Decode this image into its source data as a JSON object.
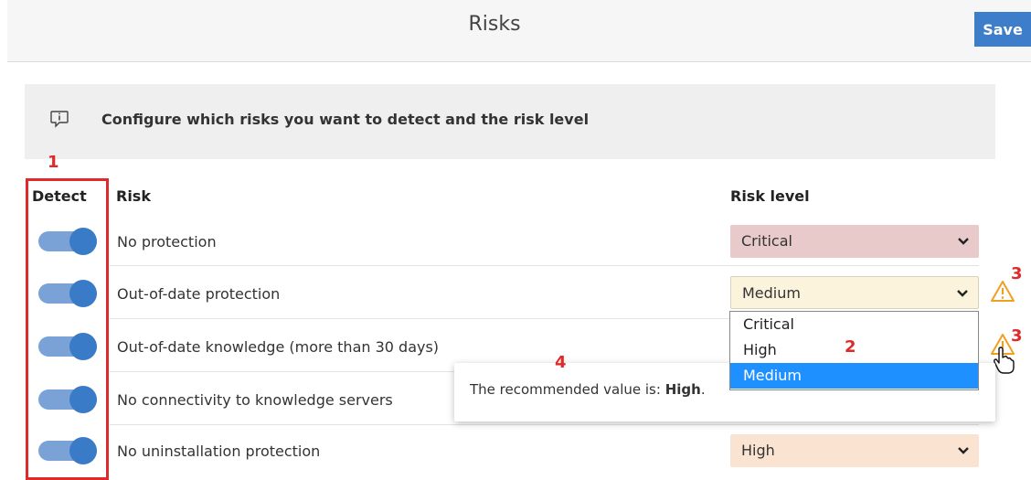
{
  "header": {
    "title": "Risks",
    "save_label": "Save"
  },
  "info": {
    "text": "Configure which risks you want to detect and the risk level",
    "icon": "info-bubble-icon"
  },
  "table": {
    "col_detect": "Detect",
    "col_risk": "Risk",
    "col_level": "Risk level",
    "rows": [
      {
        "risk": "No protection",
        "level": "Critical",
        "detect": true,
        "color": "#e8caca"
      },
      {
        "risk": "Out-of-date protection",
        "level": "Medium",
        "detect": true,
        "color": "#fbf3dc"
      },
      {
        "risk": "Out-of-date knowledge (more than 30 days)",
        "level": "",
        "detect": true
      },
      {
        "risk": "No connectivity to knowledge servers",
        "level": "",
        "detect": true
      },
      {
        "risk": "No uninstallation protection",
        "level": "High",
        "detect": true,
        "color": "#fbe3d2"
      }
    ]
  },
  "dropdown": {
    "options": [
      "Critical",
      "High",
      "Medium"
    ],
    "selected": "Medium"
  },
  "tooltip": {
    "prefix": "The recommended value is: ",
    "value": "High",
    "suffix": "."
  },
  "annotations": {
    "a1": "1",
    "a2": "2",
    "a3a": "3",
    "a3b": "3",
    "a4": "4"
  },
  "colors": {
    "accent": "#3d7dca",
    "annotation": "#e02a2a",
    "dropdown_selected": "#1e90ff",
    "warning": "#f0a020"
  }
}
